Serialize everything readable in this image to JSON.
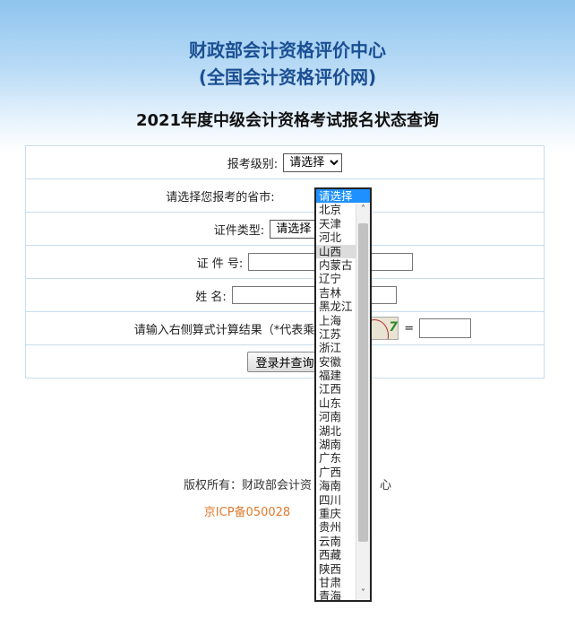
{
  "header": {
    "org_name": "财政部会计资格评价中心",
    "org_site": "(全国会计资格评价网)",
    "page_title": "2021年度中级会计资格考试报名状态查询"
  },
  "form": {
    "level_label": "报考级别:",
    "level_value": "请选择",
    "province_label": "请选择您报考的省市:",
    "id_type_label": "证件类型:",
    "id_type_value": "请选择",
    "id_number_label": "证 件 号:",
    "name_label": "姓 名:",
    "captcha_label": "请输入右侧算式计算结果（*代表乘法）",
    "captcha_visible_text": "7",
    "equals": "=",
    "submit_label": "登录并查询"
  },
  "province_dropdown": {
    "selected": "请选择",
    "hovered": "山西",
    "options": [
      "请选择",
      "北京",
      "天津",
      "河北",
      "山西",
      "内蒙古",
      "辽宁",
      "吉林",
      "黑龙江",
      "上海",
      "江苏",
      "浙江",
      "安徽",
      "福建",
      "江西",
      "山东",
      "河南",
      "湖北",
      "湖南",
      "广东",
      "广西",
      "海南",
      "四川",
      "重庆",
      "贵州",
      "云南",
      "西藏",
      "陕西",
      "甘肃",
      "青海"
    ]
  },
  "footer": {
    "copyright": "版权所有：财政部会计资",
    "copyright_tail": "心",
    "icp": "京ICP备050028"
  },
  "colors": {
    "title_blue": "#1b4f93",
    "icp_orange": "#e07a2e",
    "selection_blue": "#1e90ff"
  }
}
